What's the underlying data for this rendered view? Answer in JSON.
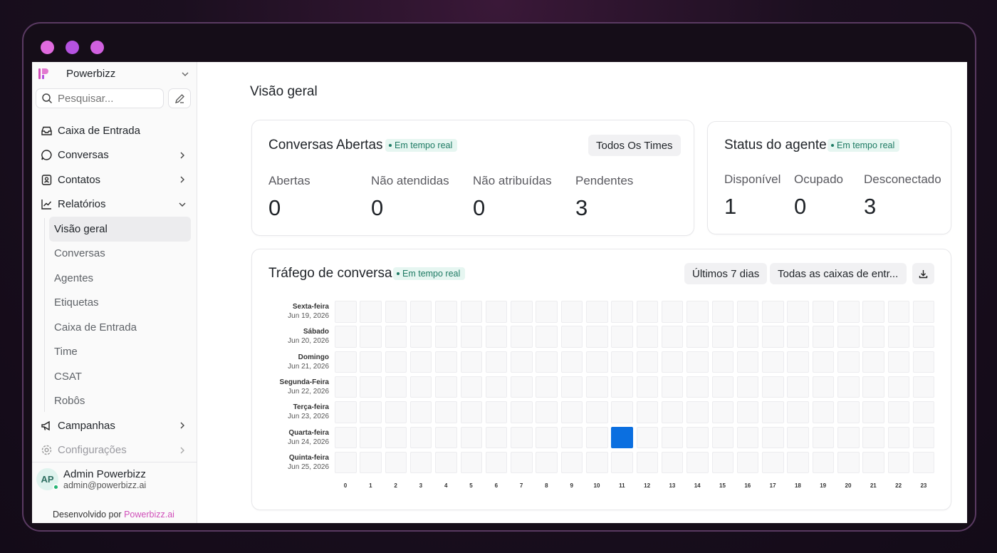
{
  "window": {
    "dot_colors": [
      "#e06adf",
      "#b552e0",
      "#d160e0"
    ]
  },
  "colors": {
    "accent": "#0b6fe0",
    "live_badge_bg": "#e6f6f1",
    "live_badge_text": "#1d7a63",
    "brand_link": "#d04fb9"
  },
  "sidebar": {
    "workspace": "Powerbizz",
    "search_placeholder": "Pesquisar...",
    "items": [
      {
        "label": "Caixa de Entrada",
        "icon": "inbox-icon"
      },
      {
        "label": "Conversas",
        "icon": "chat-bubble-icon"
      },
      {
        "label": "Contatos",
        "icon": "contact-card-icon"
      },
      {
        "label": "Relatórios",
        "icon": "chart-line-icon"
      }
    ],
    "reports_sub": [
      {
        "label": "Visão geral"
      },
      {
        "label": "Conversas"
      },
      {
        "label": "Agentes"
      },
      {
        "label": "Etiquetas"
      },
      {
        "label": "Caixa de Entrada"
      },
      {
        "label": "Time"
      },
      {
        "label": "CSAT"
      },
      {
        "label": "Robôs"
      }
    ],
    "bottom_items": [
      {
        "label": "Campanhas",
        "icon": "megaphone-icon"
      },
      {
        "label": "Configurações",
        "icon": "gear-icon"
      }
    ],
    "user": {
      "initials": "AP",
      "name": "Admin Powerbizz",
      "email": "admin@powerbizz.ai"
    },
    "footer_prefix": "Desenvolvido por",
    "footer_link": "Powerbizz.ai"
  },
  "main": {
    "title": "Visão geral",
    "open_conversations": {
      "title": "Conversas Abertas",
      "badge": "Em tempo real",
      "filter": "Todos Os Times",
      "metrics": [
        {
          "label": "Abertas",
          "value": "0"
        },
        {
          "label": "Não atendidas",
          "value": "0"
        },
        {
          "label": "Não atribuídas",
          "value": "0"
        },
        {
          "label": "Pendentes",
          "value": "3"
        }
      ]
    },
    "agent_status": {
      "title": "Status do agente",
      "badge": "Em tempo real",
      "metrics": [
        {
          "label": "Disponível",
          "value": "1"
        },
        {
          "label": "Ocupado",
          "value": "0"
        },
        {
          "label": "Desconectado",
          "value": "3"
        }
      ]
    },
    "traffic": {
      "title": "Tráfego de conversa",
      "badge": "Em tempo real",
      "range": "Últimos 7 dias",
      "inboxes": "Todas as caixas de entr...",
      "download_icon": "download-icon"
    }
  },
  "chart_data": {
    "type": "heatmap",
    "title": "Tráfego de conversa",
    "rows": [
      {
        "day": "Sexta-feira",
        "date": "Jun 19, 2026"
      },
      {
        "day": "Sábado",
        "date": "Jun 20, 2026"
      },
      {
        "day": "Domingo",
        "date": "Jun 21, 2026"
      },
      {
        "day": "Segunda-Feira",
        "date": "Jun 22, 2026"
      },
      {
        "day": "Terça-feira",
        "date": "Jun 23, 2026"
      },
      {
        "day": "Quarta-feira",
        "date": "Jun 24, 2026"
      },
      {
        "day": "Quinta-feira",
        "date": "Jun 25, 2026"
      }
    ],
    "columns": [
      "0",
      "1",
      "2",
      "3",
      "4",
      "5",
      "6",
      "7",
      "8",
      "9",
      "10",
      "11",
      "12",
      "13",
      "14",
      "15",
      "16",
      "17",
      "18",
      "19",
      "20",
      "21",
      "22",
      "23"
    ],
    "nonzero_cells": [
      {
        "row": 5,
        "column": "11",
        "level": "high"
      }
    ]
  }
}
